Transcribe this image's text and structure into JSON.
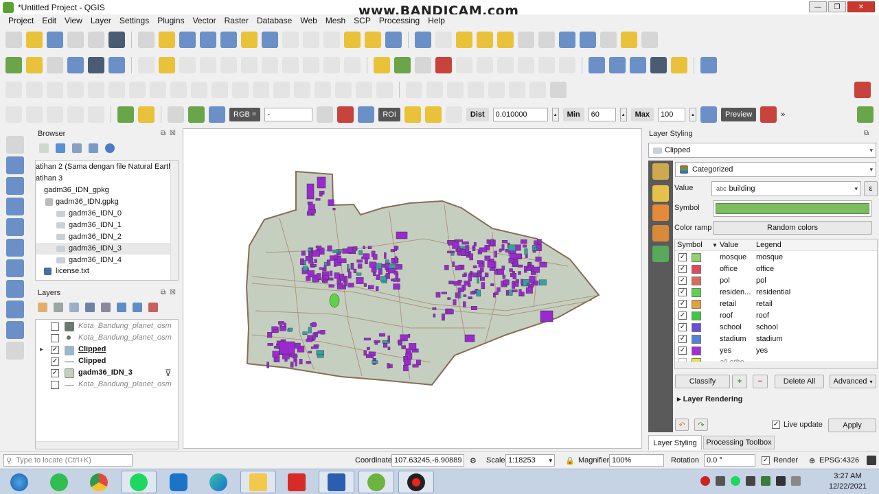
{
  "window": {
    "title": "*Untitled Project - QGIS",
    "watermark": "www.BANDICAM.com",
    "controls": {
      "minimize": "—",
      "maximize": "❐",
      "close": "✕"
    }
  },
  "menu": [
    "Project",
    "Edit",
    "View",
    "Layer",
    "Settings",
    "Plugins",
    "Vector",
    "Raster",
    "Database",
    "Web",
    "Mesh",
    "SCP",
    "Processing",
    "Help"
  ],
  "scp_toolbar": {
    "rgb_label": "RGB =",
    "rgb_value": "-",
    "roi_label": "ROI",
    "dist_label": "Dist",
    "dist_value": "0.010000",
    "min_label": "Min",
    "min_value": "60",
    "max_label": "Max",
    "max_value": "100",
    "preview_label": "Preview",
    "more": "»"
  },
  "browser": {
    "title": "Browser",
    "items": [
      "atihan 2 (Sama dengan file Natural Earth",
      "atihan 3",
      "gadm36_IDN_gpkg",
      "gadm36_IDN.gpkg",
      "gadm36_IDN_0",
      "gadm36_IDN_1",
      "gadm36_IDN_2",
      "gadm36_IDN_3",
      "gadm36_IDN_4",
      "license.txt"
    ]
  },
  "layers": {
    "title": "Layers",
    "items": [
      {
        "name": "Kota_Bandung_planet_osm",
        "checked": false,
        "style": "italic"
      },
      {
        "name": "Kota_Bandung_planet_osm",
        "checked": false,
        "style": "italic"
      },
      {
        "name": "Clipped",
        "checked": true,
        "style": "bold-underline"
      },
      {
        "name": "Clipped",
        "checked": true,
        "style": "bold"
      },
      {
        "name": "gadm36_IDN_3",
        "checked": true,
        "style": "bold"
      },
      {
        "name": "Kota_Bandung_planet_osm",
        "checked": false,
        "style": "italic"
      }
    ]
  },
  "styling": {
    "title": "Layer Styling",
    "layer": "Clipped",
    "renderer": "Categorized",
    "value_label": "Value",
    "value_field": "building",
    "symbol_label": "Symbol",
    "symbol_color": "#7dbc5f",
    "ramp_label": "Color ramp",
    "ramp_value": "Random colors",
    "columns": [
      "Symbol",
      "Value",
      "Legend"
    ],
    "categories": [
      {
        "value": "mosque",
        "legend": "mosque",
        "color": "#8fd36a",
        "checked": true
      },
      {
        "value": "office",
        "legend": "office",
        "color": "#dd4b5a",
        "checked": true
      },
      {
        "value": "pol",
        "legend": "pol",
        "color": "#d86b5a",
        "checked": true
      },
      {
        "value": "residen...",
        "legend": "residential",
        "color": "#5ed34a",
        "checked": true
      },
      {
        "value": "retail",
        "legend": "retail",
        "color": "#e3a23a",
        "checked": true
      },
      {
        "value": "roof",
        "legend": "roof",
        "color": "#3fc83f",
        "checked": true
      },
      {
        "value": "school",
        "legend": "school",
        "color": "#6a4ed8",
        "checked": true
      },
      {
        "value": "stadium",
        "legend": "stadium",
        "color": "#4f84d9",
        "checked": true
      },
      {
        "value": "yes",
        "legend": "yes",
        "color": "#a22fd3",
        "checked": true
      },
      {
        "value": "all othe...",
        "legend": "",
        "color": "#e8e83a",
        "checked": false
      }
    ],
    "buttons": {
      "classify": "Classify",
      "delete_all": "Delete All",
      "advanced": "Advanced"
    },
    "layer_rendering": "Layer Rendering",
    "live_update": "Live update",
    "apply": "Apply",
    "tabs": [
      "Layer Styling",
      "Processing Toolbox"
    ]
  },
  "statusbar": {
    "locate_placeholder": "Type to locate (Ctrl+K)",
    "coordinate_label": "Coordinate",
    "coordinate_value": "107.63245,-6.90889",
    "scale_label": "Scale",
    "scale_value": "1:18253",
    "magnifier_label": "Magnifier",
    "magnifier_value": "100%",
    "rotation_label": "Rotation",
    "rotation_value": "0.0 °",
    "render_label": "Render",
    "crs": "EPSG:4326"
  },
  "taskbar": {
    "time": "3:27 AM",
    "date": "12/22/2021"
  },
  "colors": {
    "area_fill": "#c5cfc0",
    "area_stroke": "#8a6b55",
    "building": "#9a2ad0",
    "teal_building": "#35a0a0"
  }
}
